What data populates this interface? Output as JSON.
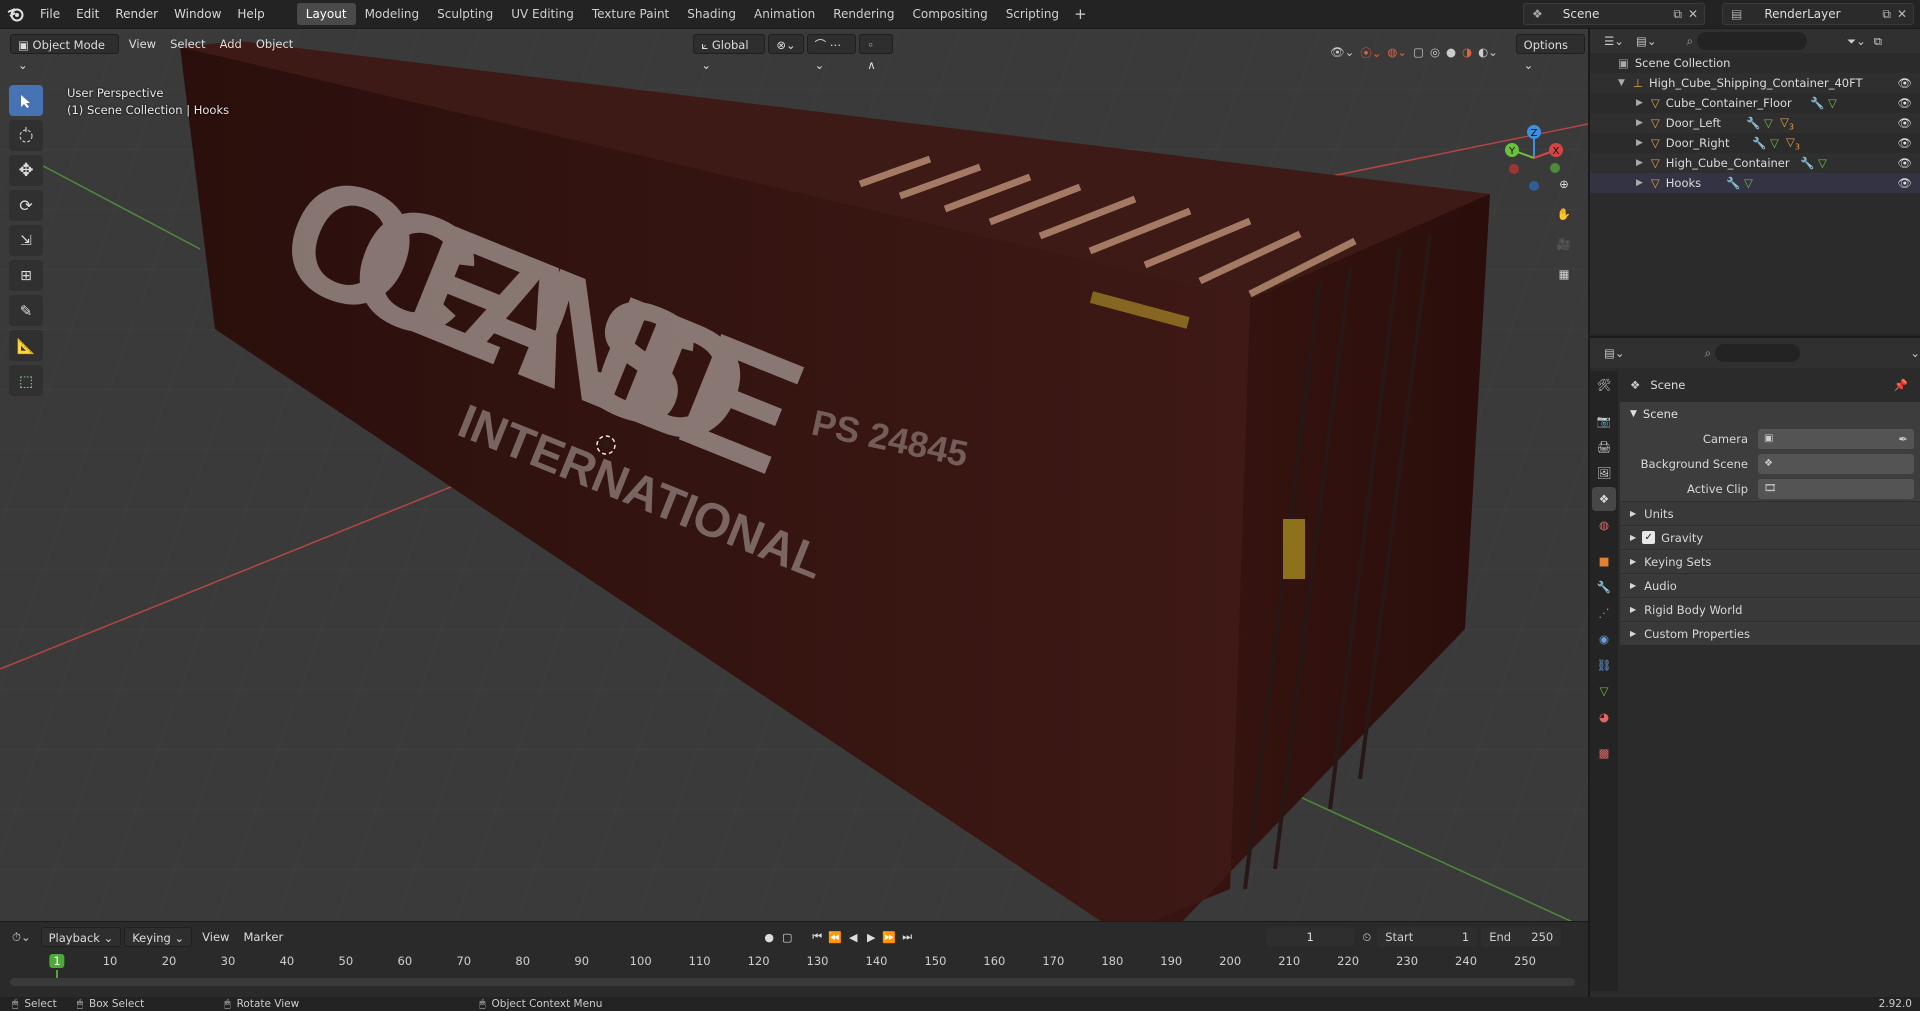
{
  "topbar": {
    "menus": [
      "File",
      "Edit",
      "Render",
      "Window",
      "Help"
    ],
    "workspaces": [
      "Layout",
      "Modeling",
      "Sculpting",
      "UV Editing",
      "Texture Paint",
      "Shading",
      "Animation",
      "Rendering",
      "Compositing",
      "Scripting"
    ],
    "active_workspace": "Layout",
    "add_tab": "+",
    "scene": "Scene",
    "view_layer": "RenderLayer"
  },
  "viewport": {
    "mode": "Object Mode",
    "menus": [
      "View",
      "Select",
      "Add",
      "Object"
    ],
    "transform_orientation": "Global",
    "options_label": "Options",
    "overlay_line1": "User Perspective",
    "overlay_line2": "(1) Scene Collection | Hooks",
    "container_text_big": "OCEANSIDE",
    "container_text_small": "INTERNATIONAL",
    "container_code": "PS 24845",
    "gizmo": {
      "x": "X",
      "y": "Y",
      "z": "Z"
    }
  },
  "outliner": {
    "root": "Scene Collection",
    "collection": "High_Cube_Shipping_Container_40FT",
    "items": [
      "Cube_Container_Floor",
      "Door_Left",
      "Door_Right",
      "High_Cube_Container",
      "Hooks"
    ],
    "badge_count": "3"
  },
  "properties": {
    "context_name": "Scene",
    "panel_title": "Scene",
    "fields": [
      {
        "label": "Camera",
        "value": ""
      },
      {
        "label": "Background Scene",
        "value": ""
      },
      {
        "label": "Active Clip",
        "value": ""
      }
    ],
    "subpanels": [
      "Units",
      "Gravity",
      "Keying Sets",
      "Audio",
      "Rigid Body World",
      "Custom Properties"
    ],
    "gravity_checked": true
  },
  "timeline": {
    "menus": [
      "Playback",
      "Keying",
      "View",
      "Marker"
    ],
    "current_frame": "1",
    "start_label": "Start",
    "start_value": "1",
    "end_label": "End",
    "end_value": "250",
    "ticks": [
      "1",
      "10",
      "20",
      "30",
      "40",
      "50",
      "60",
      "70",
      "80",
      "90",
      "100",
      "110",
      "120",
      "130",
      "140",
      "150",
      "160",
      "170",
      "180",
      "190",
      "200",
      "210",
      "220",
      "230",
      "240",
      "250"
    ]
  },
  "statusbar": {
    "items": [
      "Select",
      "Box Select",
      "Rotate View",
      "Object Context Menu"
    ],
    "version": "2.92.0"
  },
  "colors": {
    "accent": "#4772b3",
    "active_tab": "#4a4a4a",
    "container": "#3a1612",
    "x_axis": "#d64545",
    "y_axis": "#6cbf3f",
    "z_axis": "#3d8fe0",
    "frame_marker": "#4fa83a"
  }
}
